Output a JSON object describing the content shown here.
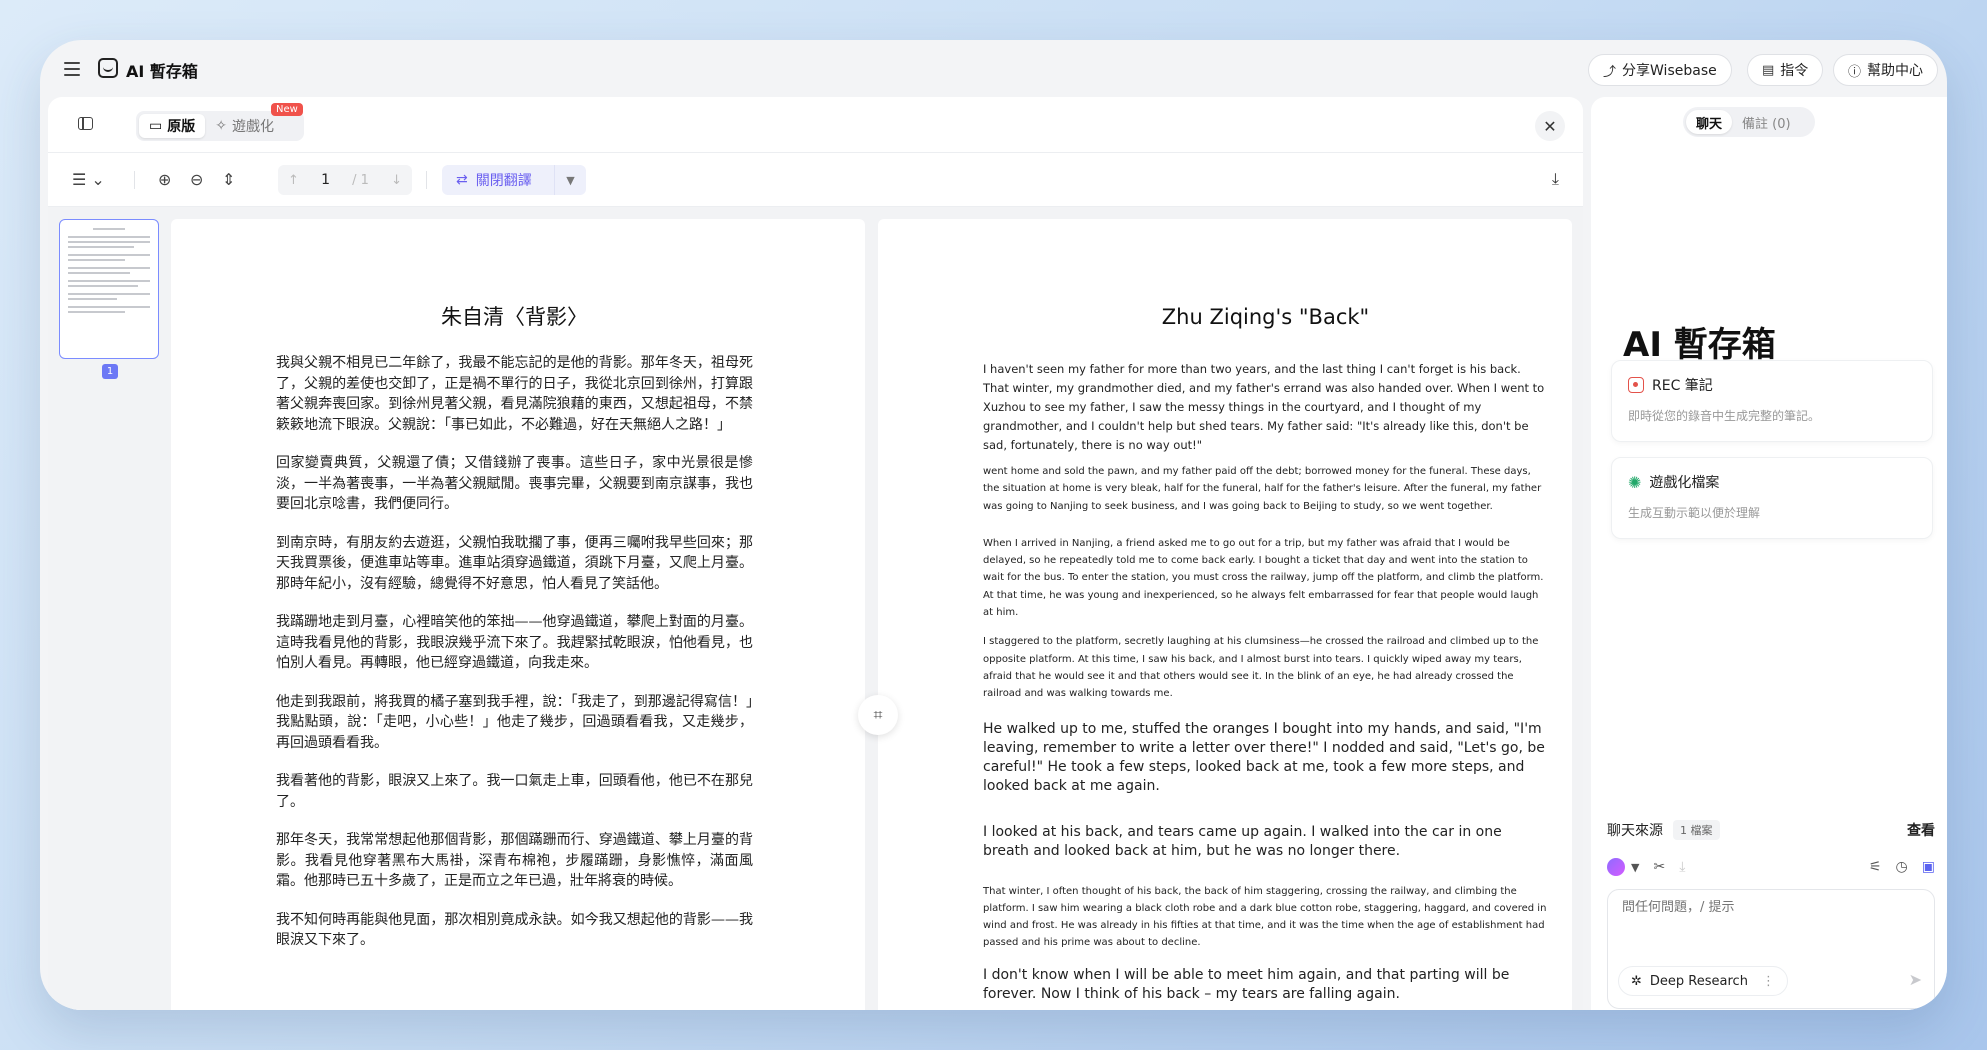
{
  "app": {
    "title": "AI 暫存箱",
    "buttons": {
      "share": "分享Wisebase",
      "commands": "指令",
      "help": "幫助中心"
    }
  },
  "reader": {
    "tabs": [
      {
        "label": "原版",
        "active": true
      },
      {
        "label": "遊戲化",
        "active": false
      }
    ],
    "new_badge": "New",
    "pager": {
      "current": "1",
      "total": "/ 1"
    },
    "translate_label": "關閉翻譯",
    "thumb_page": "1",
    "zh": {
      "title": "朱自清〈背影〉",
      "paragraphs": [
        "我與父親不相見已二年餘了，我最不能忘記的是他的背影。那年冬天，祖母死了，父親的差使也交卸了，正是禍不單行的日子，我從北京回到徐州，打算跟著父親奔喪回家。到徐州見著父親，看見滿院狼藉的東西，又想起祖母，不禁簌簌地流下眼淚。父親說：「事已如此，不必難過，好在天無絕人之路！」",
        "回家變賣典質，父親還了債；又借錢辦了喪事。這些日子，家中光景很是慘淡，一半為著喪事，一半為著父親賦閒。喪事完畢，父親要到南京謀事，我也要回北京唸書，我們便同行。",
        "到南京時，有朋友約去遊逛，父親怕我耽擱了事，便再三囑咐我早些回來；那天我買票後，便進車站等車。進車站須穿過鐵道，須跳下月臺，又爬上月臺。那時年紀小，沒有經驗，總覺得不好意思，怕人看見了笑話他。",
        "我蹣跚地走到月臺，心裡暗笑他的笨拙——他穿過鐵道，攀爬上對面的月臺。這時我看見他的背影，我眼淚幾乎流下來了。我趕緊拭乾眼淚，怕他看見，也怕別人看見。再轉眼，他已經穿過鐵道，向我走來。",
        "他走到我跟前，將我買的橘子塞到我手裡，說：「我走了，到那邊記得寫信！」我點點頭，說：「走吧，小心些！」他走了幾步，回過頭看看我，又走幾步，再回過頭看看我。",
        "我看著他的背影，眼淚又上來了。我一口氣走上車，回頭看他，他已不在那兒了。",
        "那年冬天，我常常想起他那個背影，那個蹣跚而行、穿過鐵道、攀上月臺的背影。我看見他穿著黑布大馬褂，深青布棉袍，步履蹣跚，身影憔悴，滿面風霜。他那時已五十多歲了，正是而立之年已過，壯年將衰的時候。",
        "我不知何時再能與他見面，那次相別竟成永訣。如今我又想起他的背影——我眼淚又下來了。"
      ]
    },
    "en": {
      "title": "Zhu Ziqing's \"Back\"",
      "paragraphs": [
        {
          "size": "s",
          "text": "I haven't seen my father for more than two years, and the last thing I can't forget is his back. That winter, my grandmother died, and my father's errand was also handed over. When I went to Xuzhou to see my father, I saw the messy things in the courtyard, and I thought of my grandmother, and I couldn't help but shed tears. My father said: \"It's already like this, don't be sad, fortunately, there is no way out!\""
        },
        {
          "size": "xs",
          "text": "went home and sold the pawn, and my father paid off the debt; borrowed money for the funeral. These days, the situation at home is very bleak, half for the funeral, half for the father's leisure. After the funeral, my father was going to Nanjing to seek business, and I was going back to Beijing to study, so we went together."
        },
        {
          "size": "xs",
          "text": "When I arrived in Nanjing, a friend asked me to go out for a trip, but my father was afraid that I would be delayed, so he repeatedly told me to come back early. I bought a ticket that day and went into the station to wait for the bus. To enter the station, you must cross the railway, jump off the platform, and climb the platform. At that time, he was young and inexperienced, so he always felt embarrassed for fear that people would laugh at him."
        },
        {
          "size": "xs",
          "text": "I staggered to the platform, secretly laughing at his clumsiness—he crossed the railroad and climbed up to the opposite platform. At this time, I saw his back, and I almost burst into tears. I quickly wiped away my tears, afraid that he would see it and that others would see it. In the blink of an eye, he had already crossed the railroad and was walking towards me."
        },
        {
          "size": "l",
          "text": "He walked up to me, stuffed the oranges I bought into my hands, and said, \"I'm leaving, remember to write a letter over there!\" I nodded and said, \"Let's go, be careful!\" He took a few steps, looked back at me, took a few more steps, and looked back at me again."
        },
        {
          "size": "l",
          "text": "I looked at his back, and tears came up again. I walked into the car in one breath and looked back at him, but he was no longer there."
        },
        {
          "size": "xs",
          "text": "That winter, I often thought of his back, the back of him staggering, crossing the railway, and climbing the platform. I saw him wearing a black cloth robe and a dark blue cotton robe, staggering, haggard, and covered in wind and frost. He was already in his fifties at that time, and it was the time when the age of establishment had passed and his prime was about to decline."
        },
        {
          "size": "l",
          "text": "I don't know when I will be able to meet him again, and that parting will be forever. Now I think of his back – my tears are falling again."
        }
      ]
    }
  },
  "side": {
    "tabs": [
      {
        "label": "聊天",
        "active": true
      },
      {
        "label": "備註 (0)",
        "active": false
      }
    ],
    "title": "AI 暫存箱",
    "cards": [
      {
        "title": "REC 筆記",
        "subtitle": "即時從您的錄音中生成完整的筆記。",
        "icon": "record-icon"
      },
      {
        "title": "遊戲化檔案",
        "subtitle": "生成互動示範以便於理解",
        "icon": "sparkle-icon"
      }
    ],
    "source_label": "聊天來源",
    "source_count": "1 檔案",
    "source_view": "查看",
    "input_placeholder": "問任何問題，/ 提示",
    "deep_research": "Deep Research"
  }
}
